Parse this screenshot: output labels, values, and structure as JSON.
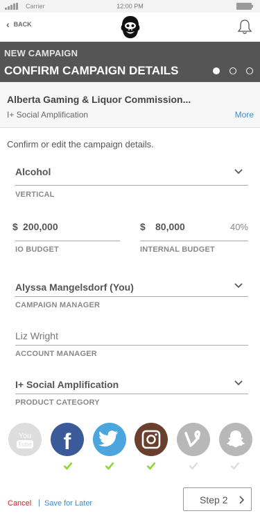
{
  "status_bar": {
    "carrier": "Carrier",
    "time": "12:00 PM"
  },
  "nav": {
    "back_label": "BACK",
    "logo_icon": "gorilla-logo",
    "notification_icon": "bell-icon"
  },
  "header": {
    "overline": "NEW CAMPAIGN",
    "title": "CONFIRM CAMPAIGN DETAILS",
    "steps_total": 3,
    "step_current": 1
  },
  "client": {
    "name": "Alberta Gaming & Liquor Commission...",
    "product": "I+ Social Amplification",
    "more_label": "More"
  },
  "intro": "Confirm or edit the campaign details.",
  "form": {
    "vertical": {
      "value": "Alcohol",
      "label": "VERTICAL"
    },
    "io_budget": {
      "currency": "$",
      "value": "200,000",
      "label": "IO BUDGET"
    },
    "internal_budget": {
      "currency": "$",
      "value": "80,000",
      "percent": "40%",
      "label": "INTERNAL BUDGET"
    },
    "campaign_manager": {
      "value": "Alyssa Mangelsdorf (You)",
      "label": "CAMPAIGN MANAGER"
    },
    "account_manager": {
      "placeholder": "Liz Wright",
      "label": "ACCOUNT MANAGER"
    },
    "product_category": {
      "value": "I+ Social Amplification",
      "label": "PRODUCT CATEGORY"
    }
  },
  "social_channels": [
    {
      "name": "youtube-icon",
      "selected": false,
      "color": "#dddddd"
    },
    {
      "name": "facebook-icon",
      "selected": true,
      "color": "#3b5a9a"
    },
    {
      "name": "twitter-icon",
      "selected": true,
      "color": "#4aa6dd"
    },
    {
      "name": "instagram-icon",
      "selected": true,
      "color": "#6b3f2e"
    },
    {
      "name": "vine-icon",
      "selected": false,
      "color": "#b8b8b8"
    },
    {
      "name": "snapchat-icon",
      "selected": false,
      "color": "#b8b8b8"
    }
  ],
  "footer": {
    "cancel_label": "Cancel",
    "separator": "|",
    "save_label": "Save for Later",
    "next_label": "Step 2"
  },
  "colors": {
    "header_bg": "#555555",
    "link": "#3a8bd6",
    "cancel": "#cc2222",
    "check_on": "#8cd630",
    "check_off": "#dddddd"
  }
}
